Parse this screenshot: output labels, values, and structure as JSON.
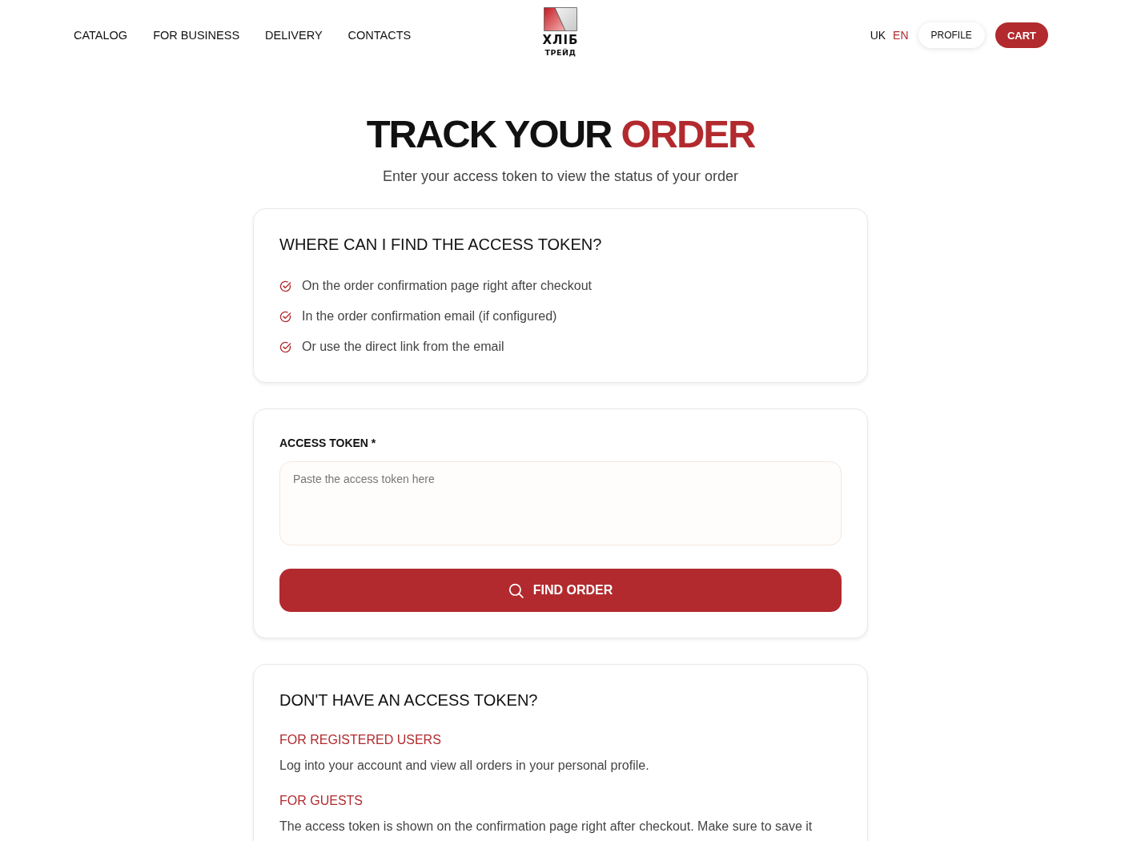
{
  "header": {
    "nav": [
      "CATALOG",
      "FOR BUSINESS",
      "DELIVERY",
      "CONTACTS"
    ],
    "logo": {
      "lines": [
        "ХЛІБ",
        "ТРЕЙД"
      ]
    },
    "languages": [
      {
        "label": "UK",
        "selected": false
      },
      {
        "label": "EN",
        "selected": true
      }
    ],
    "profile_button": "PROFILE",
    "cart_button": "CART"
  },
  "page_title": [
    {
      "text": "TRACK YOUR",
      "accent": false
    },
    {
      "text": "ORDER",
      "accent": true
    }
  ],
  "subtitle": "Enter your access token to view the status of your order",
  "help_card": {
    "title": "WHERE CAN I FIND THE ACCESS TOKEN?",
    "items": [
      "On the order confirmation page right after checkout",
      "In the order confirmation email (if configured)",
      "Or use the direct link from the email"
    ]
  },
  "token_form": {
    "label": "ACCESS TOKEN *",
    "placeholder": "Paste the access token here",
    "submit_button": "FIND ORDER"
  },
  "no_token_card": {
    "title": "DON'T HAVE AN ACCESS TOKEN?",
    "sections": [
      {
        "heading": "FOR REGISTERED USERS",
        "text": "Log into your account and view all orders in your personal profile."
      },
      {
        "heading": "FOR GUESTS",
        "text": "The access token is shown on the confirmation page right after checkout. Make sure to save it"
      }
    ]
  }
}
